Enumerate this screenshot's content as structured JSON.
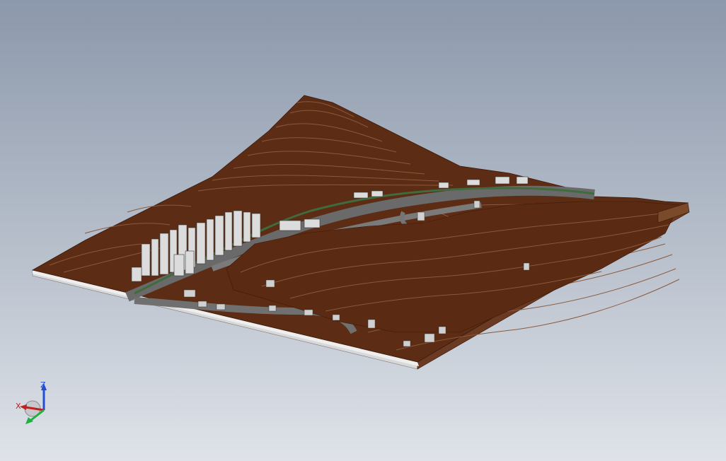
{
  "viewport": {
    "background_top": "#8c98ab",
    "background_bottom": "#dfe3e9"
  },
  "terrain_model": {
    "terrain_color": "#5c2c14",
    "contour_color": "#8a5a3c",
    "road_color": "#6a6a6a",
    "river_color": "#3f6b3f",
    "building_color": "#dcdcdc"
  },
  "triad": {
    "icon": "coordinate-triad-icon",
    "z_label": "Z",
    "x_label": "X",
    "z_color": "#2050d0",
    "x_color": "#c02020",
    "y_color": "#20b040"
  }
}
